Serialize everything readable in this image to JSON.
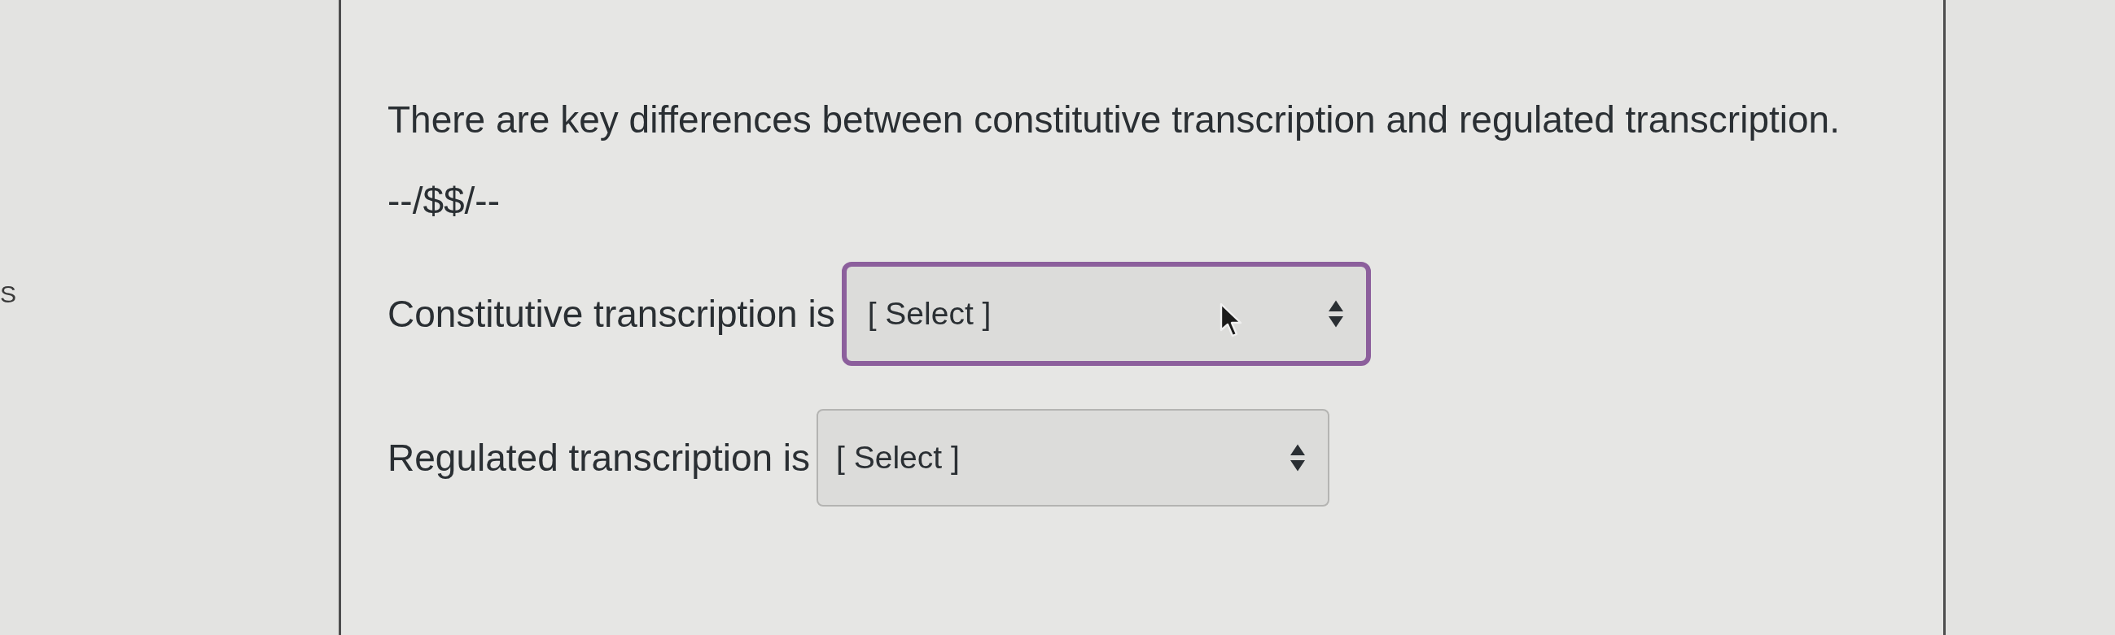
{
  "side_text": "S",
  "question": {
    "text": "There are key differences between constitutive transcription and regulated transcription.",
    "code": "--/$$/--"
  },
  "dropdowns": [
    {
      "label": "Constitutive transcription is",
      "value": "[ Select ]",
      "focused": true,
      "hovered": true
    },
    {
      "label": "Regulated transcription is",
      "value": "[ Select ]",
      "focused": false,
      "hovered": false
    }
  ]
}
